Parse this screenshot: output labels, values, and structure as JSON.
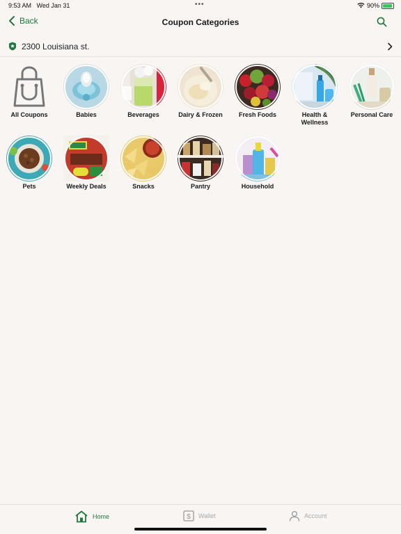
{
  "status": {
    "time": "9:53 AM",
    "date": "Wed Jan 31",
    "battery_text": "90%",
    "battery_level": 0.9
  },
  "nav": {
    "back_label": "Back",
    "title": "Coupon Categories"
  },
  "location": {
    "address": "2300 Louisiana st."
  },
  "categories": [
    {
      "label": "All Coupons",
      "icon": "shopping-bag-icon"
    },
    {
      "label": "Babies",
      "icon": "pacifier-image"
    },
    {
      "label": "Beverages",
      "icon": "beverages-image"
    },
    {
      "label": "Dairy & Frozen",
      "icon": "ice-cream-image"
    },
    {
      "label": "Fresh Foods",
      "icon": "fruit-bowl-image"
    },
    {
      "label": "Health & Wellness",
      "icon": "health-bottles-image"
    },
    {
      "label": "Personal Care",
      "icon": "personal-care-image"
    },
    {
      "label": "Pets",
      "icon": "pet-food-image"
    },
    {
      "label": "Weekly Deals",
      "icon": "weekly-deals-image"
    },
    {
      "label": "Snacks",
      "icon": "chips-image"
    },
    {
      "label": "Pantry",
      "icon": "pantry-shelf-image"
    },
    {
      "label": "Household",
      "icon": "cleaning-supplies-image"
    }
  ],
  "tabs": {
    "home": "Home",
    "wallet": "Wallet",
    "account": "Account"
  },
  "colors": {
    "accent": "#1e7a3c",
    "background": "#f9f5f2",
    "inactive": "#aaaaaa"
  }
}
